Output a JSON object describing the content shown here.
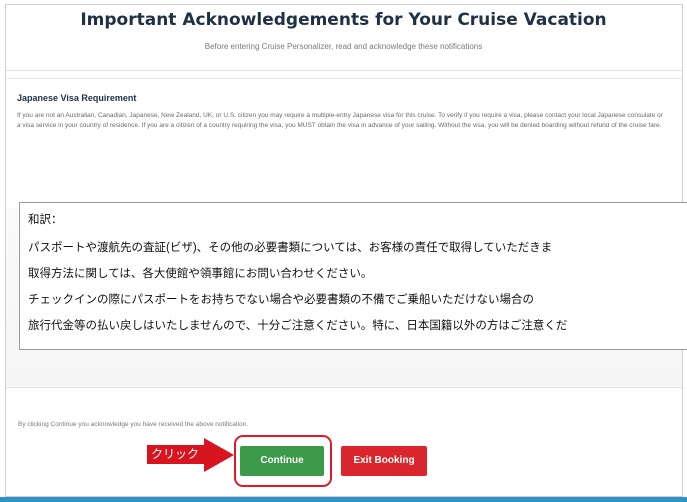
{
  "dialog": {
    "title": "Important Acknowledgements for Your Cruise Vacation",
    "subtitle": "Before entering Cruise Personalizer, read and acknowledge these notifications"
  },
  "visa_notice": {
    "heading": "Japanese Visa Requirement",
    "body": "If you are not an Australian, Canadian, Japanese, New Zealand, UK, or U.S. citizen you may require a multiple-entry Japanese visa for this cruise. To verify if you require a visa, please contact your local Japanese consulate or a visa service in your country of residence. If you are a citizen of a country requiring the visa, you MUST obtain the visa in advance of your sailing. Without the visa, you will be denied boarding without refund of the cruise fare."
  },
  "translation": {
    "heading": "和訳：",
    "lines": [
      "パスポートや渡航先の査証(ビザ)、その他の必要書類については、お客様の責任で取得していただきま",
      "取得方法に関しては、各大使館や領事館にお問い合わせください。",
      "チェックインの際にパスポートをお持ちでない場合や必要書類の不備でご乗船いただけない場合の",
      "旅行代金等の払い戻しはいたしませんので、十分ご注意ください。特に、日本国籍以外の方はご注意くだ"
    ]
  },
  "footer": {
    "note": "By clicking Continue you acknowledge you have received the above notification.",
    "continue_label": "Continue",
    "exit_label": "Exit Booking"
  },
  "annotation": {
    "label": "クリック",
    "color": "#d8141f"
  },
  "colors": {
    "continue_green": "#3c9a4a",
    "exit_red": "#d9252b",
    "title_navy": "#1f3144",
    "bottom_bar": "#2f93c9"
  }
}
